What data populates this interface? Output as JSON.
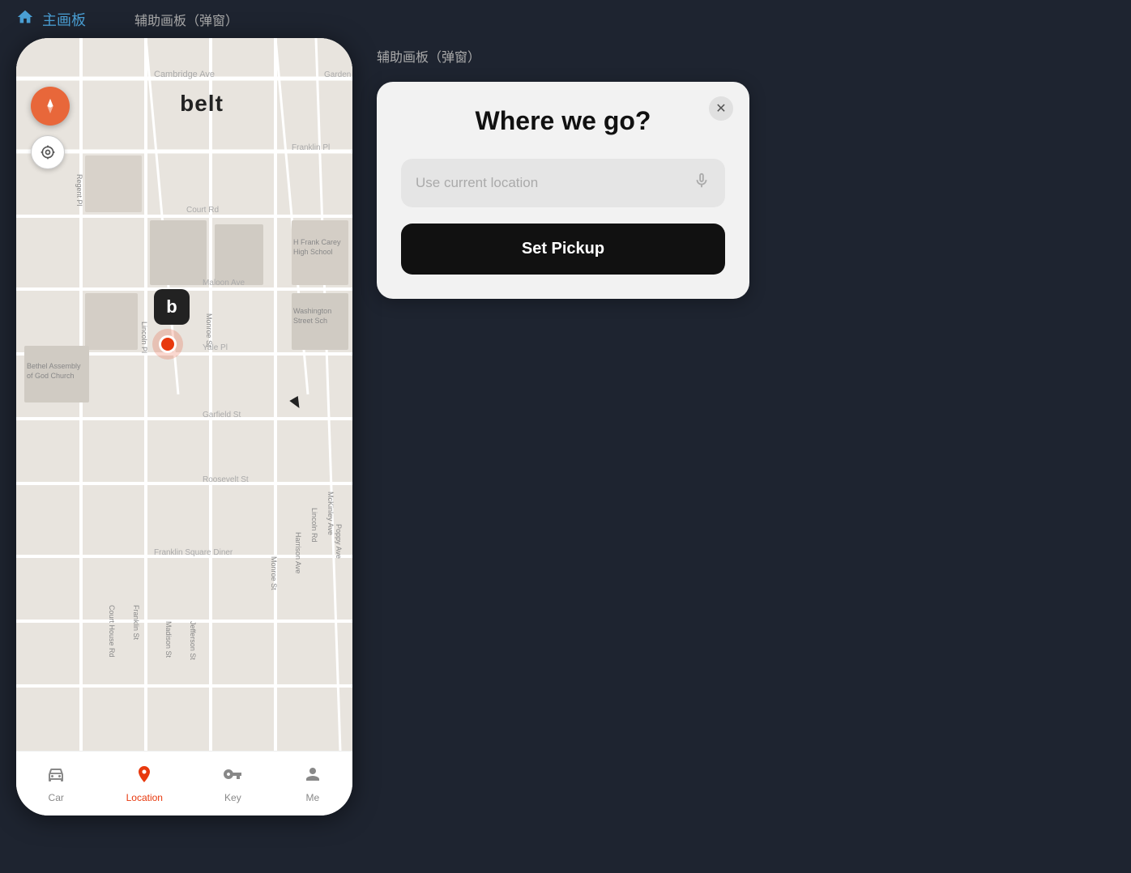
{
  "topbar": {
    "main_label": "主画板",
    "sub_label": "辅助画板（弹窗）"
  },
  "map": {
    "belt_label": "belt",
    "compass_icon": "▲",
    "locate_icon": "◎",
    "marker_letter": "b"
  },
  "nav": {
    "items": [
      {
        "id": "car",
        "label": "Car",
        "icon": "🚗",
        "active": false
      },
      {
        "id": "location",
        "label": "Location",
        "icon": "📍",
        "active": true
      },
      {
        "id": "key",
        "label": "Key",
        "icon": "🔑",
        "active": false
      },
      {
        "id": "me",
        "label": "Me",
        "icon": "👤",
        "active": false
      }
    ]
  },
  "popup": {
    "title": "Where we go?",
    "input_placeholder": "Use current location",
    "set_pickup_label": "Set Pickup",
    "close_icon": "✕"
  }
}
